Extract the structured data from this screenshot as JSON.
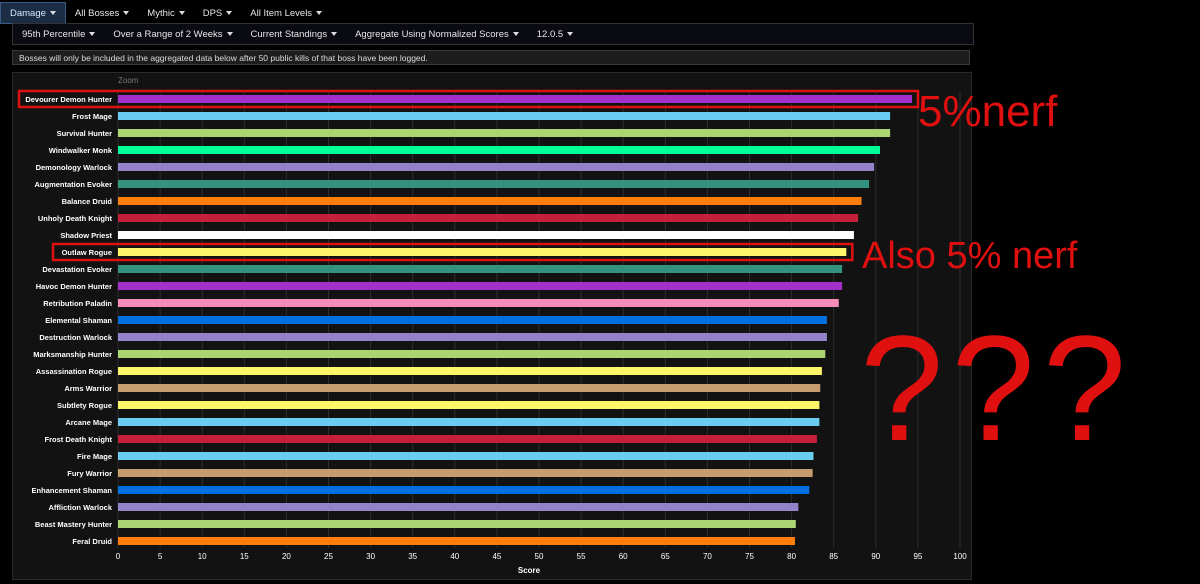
{
  "filters_top": [
    {
      "label": "Damage",
      "active": true
    },
    {
      "label": "All Bosses",
      "active": false
    },
    {
      "label": "Mythic",
      "active": false
    },
    {
      "label": "DPS",
      "active": false
    },
    {
      "label": "All Item Levels",
      "active": false
    }
  ],
  "filters_second": [
    {
      "label": "95th Percentile"
    },
    {
      "label": "Over a Range of 2 Weeks"
    },
    {
      "label": "Current Standings"
    },
    {
      "label": "Aggregate Using Normalized Scores"
    },
    {
      "label": "12.0.5"
    }
  ],
  "notice": "Bosses will only be included in the aggregated data below after 50 public kills of that boss have been logged.",
  "zoom_label": "Zoom",
  "annotations": {
    "nerf1": "5%nerf",
    "nerf2": "Also 5% nerf",
    "question_marks": "???"
  },
  "chart_data": {
    "type": "bar",
    "orientation": "horizontal",
    "xlabel": "Score",
    "xlim": [
      0,
      100
    ],
    "xticks": [
      0,
      5,
      10,
      15,
      20,
      25,
      30,
      35,
      40,
      45,
      50,
      55,
      60,
      65,
      70,
      75,
      80,
      85,
      90,
      95,
      100
    ],
    "grid": true,
    "categories": [
      "Devourer Demon Hunter",
      "Frost Mage",
      "Survival Hunter",
      "Windwalker Monk",
      "Demonology Warlock",
      "Augmentation Evoker",
      "Balance Druid",
      "Unholy Death Knight",
      "Shadow Priest",
      "Outlaw Rogue",
      "Devastation Evoker",
      "Havoc Demon Hunter",
      "Retribution Paladin",
      "Elemental Shaman",
      "Destruction Warlock",
      "Marksmanship Hunter",
      "Assassination Rogue",
      "Arms Warrior",
      "Subtlety Rogue",
      "Arcane Mage",
      "Frost Death Knight",
      "Fire Mage",
      "Fury Warrior",
      "Enhancement Shaman",
      "Affliction Warlock",
      "Beast Mastery Hunter",
      "Feral Druid"
    ],
    "values": [
      94.3,
      91.7,
      91.7,
      90.5,
      89.8,
      89.2,
      88.3,
      87.9,
      87.4,
      86.5,
      86.0,
      86.0,
      85.6,
      84.2,
      84.2,
      84.0,
      83.6,
      83.4,
      83.3,
      83.3,
      83.0,
      82.6,
      82.5,
      82.1,
      80.8,
      80.5,
      80.4
    ],
    "colors": [
      "#a330c9",
      "#69ccf0",
      "#abd473",
      "#00ff96",
      "#9482c9",
      "#33937f",
      "#ff7d0a",
      "#c41f3b",
      "#ffffff",
      "#fff569",
      "#33937f",
      "#a330c9",
      "#f58cba",
      "#0070de",
      "#9482c9",
      "#abd473",
      "#fff569",
      "#c79c6e",
      "#fff569",
      "#69ccf0",
      "#c41f3b",
      "#69ccf0",
      "#c79c6e",
      "#0070de",
      "#9482c9",
      "#abd473",
      "#ff7d0a"
    ],
    "highlighted": [
      "Devourer Demon Hunter",
      "Outlaw Rogue"
    ]
  }
}
